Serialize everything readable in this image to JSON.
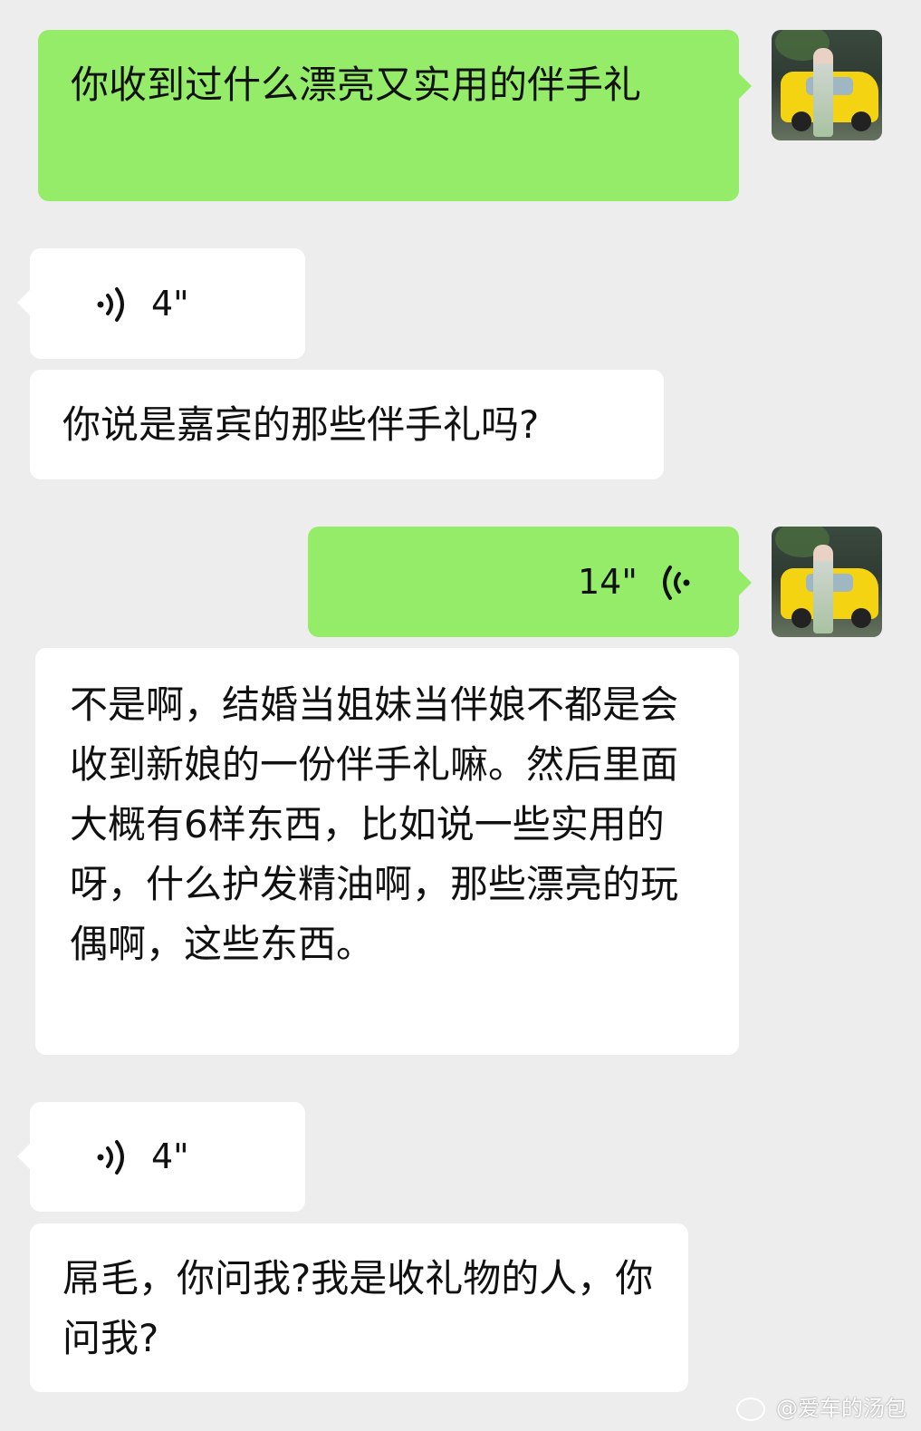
{
  "messages": {
    "m1_text": "你收到过什么漂亮又实用的伴手礼",
    "m2_duration": "4\"",
    "m3_text": "你说是嘉宾的那些伴手礼吗?",
    "m4_duration": "14\"",
    "m5_text": "不是啊，结婚当姐妹当伴娘不都是会收到新娘的一份伴手礼嘛。然后里面大概有6样东西，比如说一些实用的呀，什么护发精油啊，那些漂亮的玩偶啊，这些东西。",
    "m6_duration": "4\"",
    "m7_text": "屌毛，你问我?我是收礼物的人，你问我?"
  },
  "watermark": "@爱车的汤包",
  "colors": {
    "sent_bubble": "#95ec69",
    "received_bubble": "#ffffff",
    "background": "#ededed"
  },
  "icons": {
    "voice_incoming": "voice-wave-icon",
    "voice_outgoing": "voice-wave-icon",
    "watermark": "weibo-icon"
  }
}
